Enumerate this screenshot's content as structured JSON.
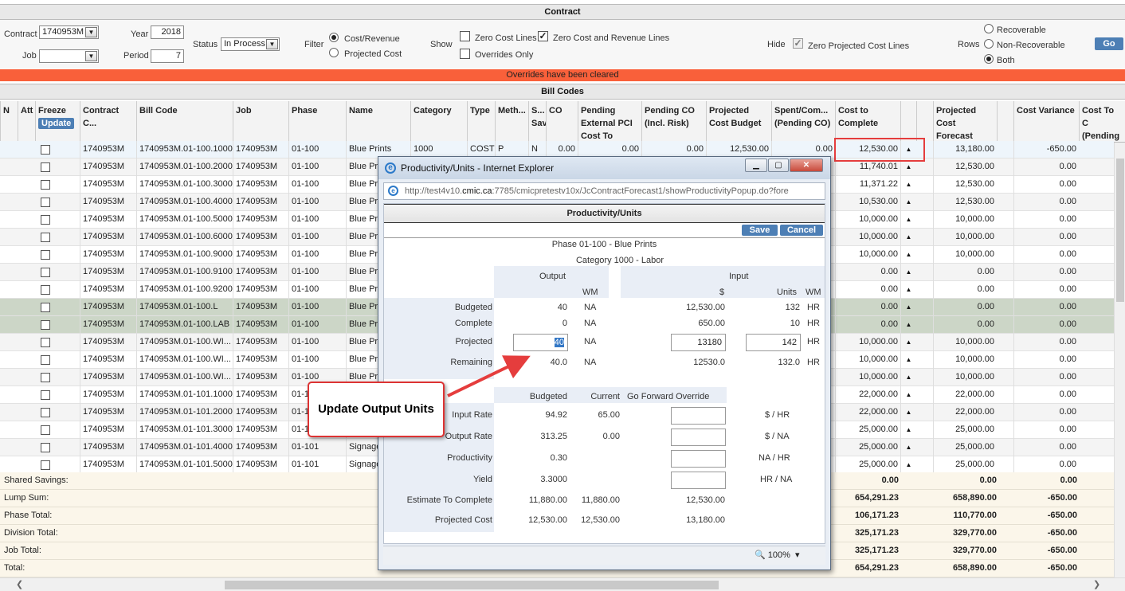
{
  "contract_section": {
    "title": "Contract",
    "contract_label": "Contract",
    "contract_value": "1740953M",
    "job_label": "Job",
    "job_value": "",
    "year_label": "Year",
    "year_value": "2018",
    "period_label": "Period",
    "period_value": "7",
    "status_label": "Status",
    "status_value": "In Process",
    "filter_label": "Filter",
    "filter_cost_revenue": "Cost/Revenue",
    "filter_projected_cost": "Projected Cost",
    "show_label": "Show",
    "show_zero_cost": "Zero Cost Lines",
    "show_zero_cost_revenue": "Zero Cost and Revenue Lines",
    "show_overrides_only": "Overrides Only",
    "hide_label": "Hide",
    "hide_zero_projected": "Zero Projected Cost Lines",
    "rows_label": "Rows",
    "rows_recoverable": "Recoverable",
    "rows_non_recoverable": "Non-Recoverable",
    "rows_both": "Both",
    "go_label": "Go"
  },
  "banner_text": "Overrides have been cleared",
  "bill_codes_title": "Bill Codes",
  "columns": {
    "n": "N",
    "att": "Att",
    "freeze": "Freeze",
    "update": "Update",
    "contract_code": "Contract C...",
    "bill_code": "Bill Code",
    "job": "Job",
    "phase": "Phase",
    "name": "Name",
    "category": "Category",
    "type": "Type",
    "method": "Meth...",
    "sav": "S... Sav",
    "co": "CO",
    "pending_external": "Pending External PCI Cost To Compl",
    "pending_co": "Pending CO (Incl. Risk)",
    "projected_cost_budget": "Projected Cost Budget",
    "spent_committed": "Spent/Com... (Pending CO)",
    "cost_to_complete": "Cost to Complete",
    "projected_cost_forecast": "Projected Cost Forecast",
    "cost_variance": "Cost Variance",
    "cost_to_complete_pending": "Cost To C (Pending C"
  },
  "rows": [
    {
      "contract": "1740953M",
      "bill_code": "1740953M.01-100.1000",
      "job": "1740953M",
      "phase": "01-100",
      "name": "Blue Prints",
      "category": "1000",
      "type": "COST",
      "method": "P",
      "sav": "N",
      "co": "0.00",
      "pending_ext": "0.00",
      "pending_co": "0.00",
      "budget": "12,530.00",
      "spent": "0.00",
      "ctc": "12,530.00",
      "forecast": "13,180.00",
      "variance": "-650.00"
    },
    {
      "contract": "1740953M",
      "bill_code": "1740953M.01-100.2000",
      "job": "1740953M",
      "phase": "01-100",
      "name": "Blue Pri",
      "ctc": "11,740.01",
      "forecast": "12,530.00",
      "variance": "0.00"
    },
    {
      "contract": "1740953M",
      "bill_code": "1740953M.01-100.3000",
      "job": "1740953M",
      "phase": "01-100",
      "name": "Blue Pri",
      "ctc": "11,371.22",
      "forecast": "12,530.00",
      "variance": "0.00"
    },
    {
      "contract": "1740953M",
      "bill_code": "1740953M.01-100.4000",
      "job": "1740953M",
      "phase": "01-100",
      "name": "Blue Pri",
      "ctc": "10,530.00",
      "forecast": "12,530.00",
      "variance": "0.00"
    },
    {
      "contract": "1740953M",
      "bill_code": "1740953M.01-100.5000",
      "job": "1740953M",
      "phase": "01-100",
      "name": "Blue Pri",
      "ctc": "10,000.00",
      "forecast": "10,000.00",
      "variance": "0.00"
    },
    {
      "contract": "1740953M",
      "bill_code": "1740953M.01-100.6000",
      "job": "1740953M",
      "phase": "01-100",
      "name": "Blue Pri",
      "ctc": "10,000.00",
      "forecast": "10,000.00",
      "variance": "0.00"
    },
    {
      "contract": "1740953M",
      "bill_code": "1740953M.01-100.9000",
      "job": "1740953M",
      "phase": "01-100",
      "name": "Blue Pri",
      "ctc": "10,000.00",
      "forecast": "10,000.00",
      "variance": "0.00"
    },
    {
      "contract": "1740953M",
      "bill_code": "1740953M.01-100.9100",
      "job": "1740953M",
      "phase": "01-100",
      "name": "Blue Pri",
      "ctc": "0.00",
      "forecast": "0.00",
      "variance": "0.00"
    },
    {
      "contract": "1740953M",
      "bill_code": "1740953M.01-100.9200",
      "job": "1740953M",
      "phase": "01-100",
      "name": "Blue Pri",
      "ctc": "0.00",
      "forecast": "0.00",
      "variance": "0.00"
    },
    {
      "contract": "1740953M",
      "bill_code": "1740953M.01-100.L",
      "job": "1740953M",
      "phase": "01-100",
      "name": "Blue Pri",
      "ctc": "0.00",
      "forecast": "0.00",
      "variance": "0.00"
    },
    {
      "contract": "1740953M",
      "bill_code": "1740953M.01-100.LAB",
      "job": "1740953M",
      "phase": "01-100",
      "name": "Blue Pri",
      "ctc": "0.00",
      "forecast": "0.00",
      "variance": "0.00"
    },
    {
      "contract": "1740953M",
      "bill_code": "1740953M.01-100.WI...",
      "job": "1740953M",
      "phase": "01-100",
      "name": "Blue Pri",
      "ctc": "10,000.00",
      "forecast": "10,000.00",
      "variance": "0.00"
    },
    {
      "contract": "1740953M",
      "bill_code": "1740953M.01-100.WI...",
      "job": "1740953M",
      "phase": "01-100",
      "name": "Blue Pri",
      "ctc": "10,000.00",
      "forecast": "10,000.00",
      "variance": "0.00"
    },
    {
      "contract": "1740953M",
      "bill_code": "1740953M.01-100.WI...",
      "job": "1740953M",
      "phase": "01-100",
      "name": "Blue Pri",
      "ctc": "10,000.00",
      "forecast": "10,000.00",
      "variance": "0.00"
    },
    {
      "contract": "1740953M",
      "bill_code": "1740953M.01-101.1000",
      "job": "1740953M",
      "phase": "01-1",
      "name": "",
      "ctc": "22,000.00",
      "forecast": "22,000.00",
      "variance": "0.00"
    },
    {
      "contract": "1740953M",
      "bill_code": "1740953M.01-101.2000",
      "job": "1740953M",
      "phase": "01-1",
      "name": "",
      "ctc": "22,000.00",
      "forecast": "22,000.00",
      "variance": "0.00"
    },
    {
      "contract": "1740953M",
      "bill_code": "1740953M.01-101.3000",
      "job": "1740953M",
      "phase": "01-1",
      "name": "",
      "ctc": "25,000.00",
      "forecast": "25,000.00",
      "variance": "0.00"
    },
    {
      "contract": "1740953M",
      "bill_code": "1740953M.01-101.4000",
      "job": "1740953M",
      "phase": "01-101",
      "name": "Signage",
      "ctc": "25,000.00",
      "forecast": "25,000.00",
      "variance": "0.00"
    },
    {
      "contract": "1740953M",
      "bill_code": "1740953M.01-101.5000",
      "job": "1740953M",
      "phase": "01-101",
      "name": "Signage",
      "ctc": "25,000.00",
      "forecast": "25,000.00",
      "variance": "0.00"
    }
  ],
  "totals": [
    {
      "label": "Shared Savings:",
      "ctc": "0.00",
      "forecast": "0.00",
      "variance": "0.00"
    },
    {
      "label": "Lump Sum:",
      "ctc": "654,291.23",
      "forecast": "658,890.00",
      "variance": "-650.00"
    },
    {
      "label": "Phase Total:",
      "ctc": "106,171.23",
      "forecast": "110,770.00",
      "variance": "-650.00"
    },
    {
      "label": "Division Total:",
      "ctc": "325,171.23",
      "forecast": "329,770.00",
      "variance": "-650.00"
    },
    {
      "label": "Job Total:",
      "ctc": "325,171.23",
      "forecast": "329,770.00",
      "variance": "-650.00"
    },
    {
      "label": "Total:",
      "ctc": "654,291.23",
      "forecast": "658,890.00",
      "variance": "-650.00"
    }
  ],
  "popup": {
    "window_title": "Productivity/Units - Internet Explorer",
    "url_prefix": "http://test4v10.",
    "url_domain": "cmic.ca",
    "url_suffix": ":7785/cmicpretestv10x/JcContractForecast1/showProductivityPopup.do?fore",
    "heading": "Productivity/Units",
    "save_label": "Save",
    "cancel_label": "Cancel",
    "phase_line": "Phase 01-100 - Blue Prints",
    "category_line": "Category 1000 - Labor",
    "output_label": "Output",
    "input_label": "Input",
    "wm_label": "WM",
    "dollar_label": "$",
    "units_label": "Units",
    "budgeted_label": "Budgeted",
    "budgeted_output": "40",
    "budgeted_wm": "NA",
    "budgeted_dollar": "12,530.00",
    "budgeted_units": "132",
    "budgeted_units_wm": "HR",
    "complete_label": "Complete",
    "complete_output": "0",
    "complete_wm": "NA",
    "complete_dollar": "650.00",
    "complete_units": "10",
    "complete_units_wm": "HR",
    "projected_label": "Projected",
    "projected_output": "40",
    "projected_wm": "NA",
    "projected_dollar": "13180",
    "projected_units": "142",
    "projected_units_wm": "HR",
    "remaining_label": "Remaining",
    "remaining_output": "40.0",
    "remaining_wm": "NA",
    "remaining_dollar": "12530.0",
    "remaining_units": "132.0",
    "remaining_units_wm": "HR",
    "rates_budgeted_label": "Budgeted",
    "rates_current_label": "Current",
    "rates_override_label": "Go Forward Override",
    "input_rate_label": "Input Rate",
    "input_rate_budgeted": "94.92",
    "input_rate_current": "65.00",
    "input_rate_unit": "$ / HR",
    "output_rate_label": "Output Rate",
    "output_rate_budgeted": "313.25",
    "output_rate_current": "0.00",
    "output_rate_unit": "$ / NA",
    "productivity_label": "Productivity",
    "productivity_budgeted": "0.30",
    "productivity_unit": "NA / HR",
    "yield_label": "Yield",
    "yield_budgeted": "3.3000",
    "yield_unit": "HR / NA",
    "etc_label": "Estimate To Complete",
    "etc_budgeted": "11,880.00",
    "etc_current": "11,880.00",
    "etc_input": "12,530.00",
    "proj_cost_label": "Projected Cost",
    "proj_cost_budgeted": "12,530.00",
    "proj_cost_current": "12,530.00",
    "proj_cost_input": "13,180.00",
    "zoom_level": "100%"
  },
  "callout_text": "Update Output Units"
}
